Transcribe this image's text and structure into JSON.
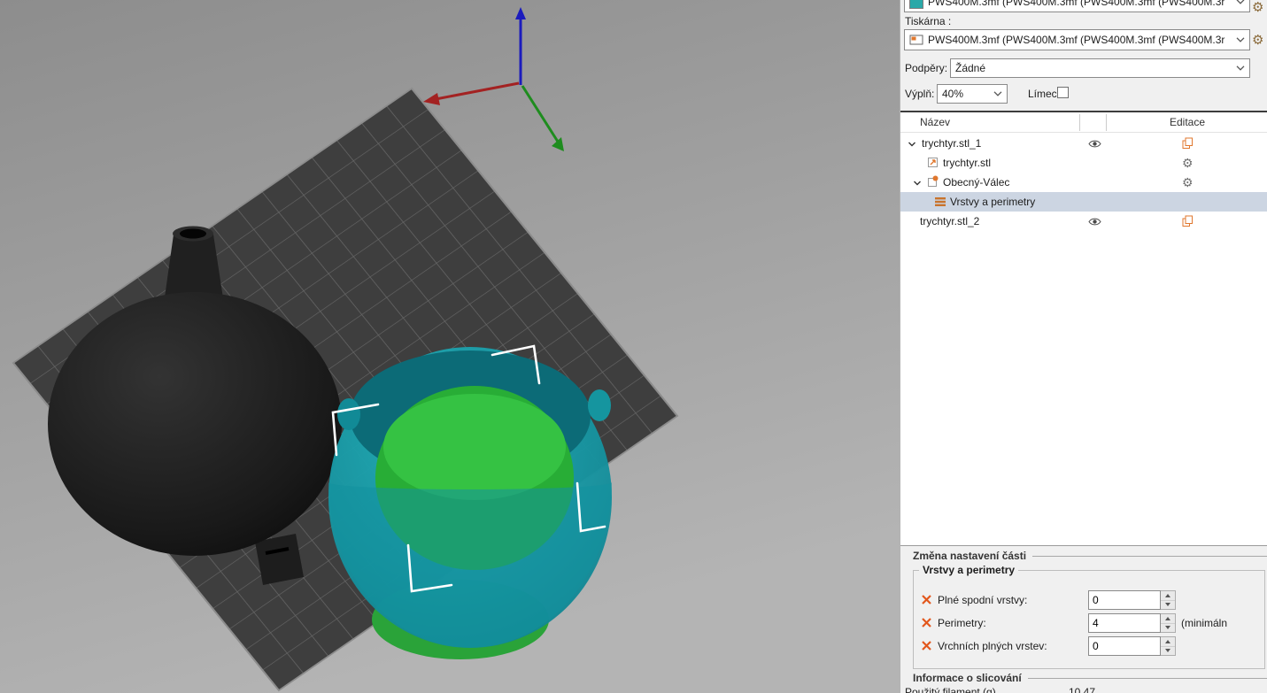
{
  "colors": {
    "filament_swatch": "#2aa8a8",
    "model_teal": "#1796a2",
    "modifier_green": "#2db53c",
    "selected_row_bg": "#ccd5e2",
    "bed_gray": "#3e3e3e",
    "accent_orange": "#e0772e"
  },
  "icons": {
    "gear": "⚙"
  },
  "right_panel": {
    "filament_combo_value": "PWS400M.3mf (PWS400M.3mf (PWS400M.3mf (PWS400M.3r",
    "printer_label": "Tiskárna :",
    "printer_combo_value": "PWS400M.3mf (PWS400M.3mf (PWS400M.3mf (PWS400M.3r",
    "supports_label": "Podpěry:",
    "supports_value": "Žádné",
    "infill_label": "Výplň:",
    "infill_value": "40%",
    "brim_label": "Límec:",
    "tree": {
      "name_header": "Název",
      "edit_header": "Editace",
      "rows": [
        {
          "label": "trychtyr.stl_1"
        },
        {
          "label": "trychtyr.stl"
        },
        {
          "label": "Obecný-Válec"
        },
        {
          "label": "Vrstvy a perimetry"
        },
        {
          "label": "trychtyr.stl_2"
        }
      ]
    },
    "part_settings": {
      "section_title": "Změna nastavení části",
      "group_title": "Vrstvy a perimetry",
      "rows": [
        {
          "label": "Plné spodní vrstvy:",
          "value": "0",
          "suffix": ""
        },
        {
          "label": "Perimetry:",
          "value": "4",
          "suffix": "(minimáln"
        },
        {
          "label": "Vrchních plných vrstev:",
          "value": "0",
          "suffix": ""
        }
      ]
    },
    "slicing_info": {
      "section_title": "Informace o slicování",
      "filament_label": "Použitý filament (g)",
      "filament_value": "10.47"
    }
  },
  "viewport": {
    "models": [
      {
        "name": "trychtyr.stl_1",
        "color": "#151515"
      },
      {
        "name": "trychtyr.stl_2",
        "color": "#1796a2",
        "selected": true
      },
      {
        "name": "Obecný-Válec",
        "color": "#2db53c"
      }
    ]
  }
}
